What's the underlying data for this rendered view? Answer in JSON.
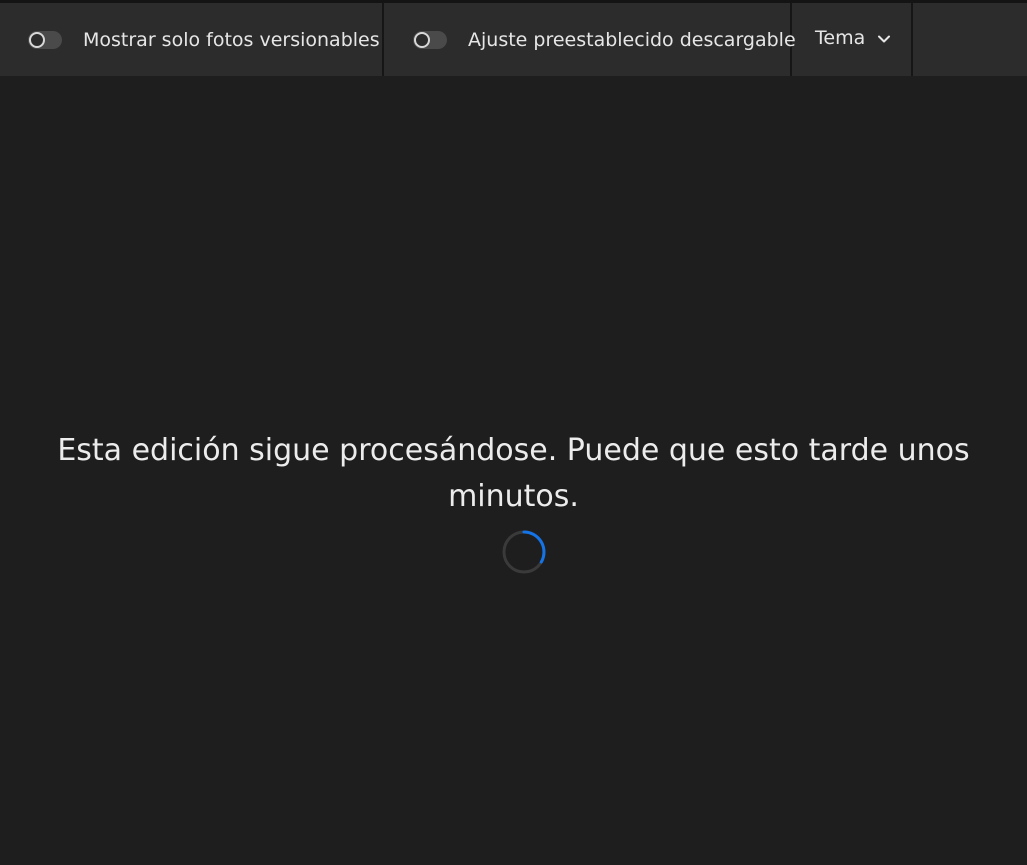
{
  "toolbar": {
    "toggles": [
      {
        "label": "Mostrar solo fotos versionables",
        "on": false
      },
      {
        "label": "Ajuste preestablecido descargable",
        "on": false
      }
    ],
    "theme": {
      "label": "Tema",
      "icon": "chevron-down-icon"
    }
  },
  "main": {
    "status_message": "Esta edición sigue procesándose. Puede que esto tarde unos minutos.",
    "spinner_icon": "loading-spinner-icon"
  },
  "colors": {
    "background": "#1e1e1e",
    "toolbar": "#2c2c2c",
    "spinner_accent": "#1473e6",
    "spinner_track": "#3a3a3a"
  }
}
